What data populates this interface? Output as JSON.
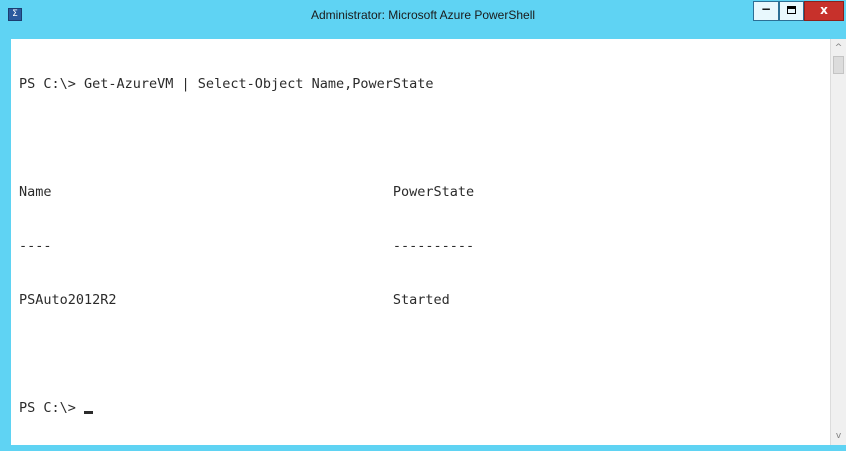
{
  "window": {
    "title": "Administrator: Microsoft Azure PowerShell",
    "app_icon_glyph": "Σ",
    "controls": {
      "minimize": "−",
      "close": "x"
    }
  },
  "console": {
    "lines": [
      "PS C:\\> Get-AzureVM | Select-Object Name,PowerState",
      "",
      "Name                                          PowerState",
      "----                                          ----------",
      "PSAuto2012R2                                  Started",
      "",
      ""
    ],
    "prompt": "PS C:\\> "
  },
  "scrollbar": {
    "up_glyph": "^",
    "down_glyph": "v"
  },
  "colors": {
    "titlebar": "#5fd3f3",
    "close_button": "#c7312b",
    "console_background": "#ffffff",
    "console_text": "#2b2b2b"
  }
}
